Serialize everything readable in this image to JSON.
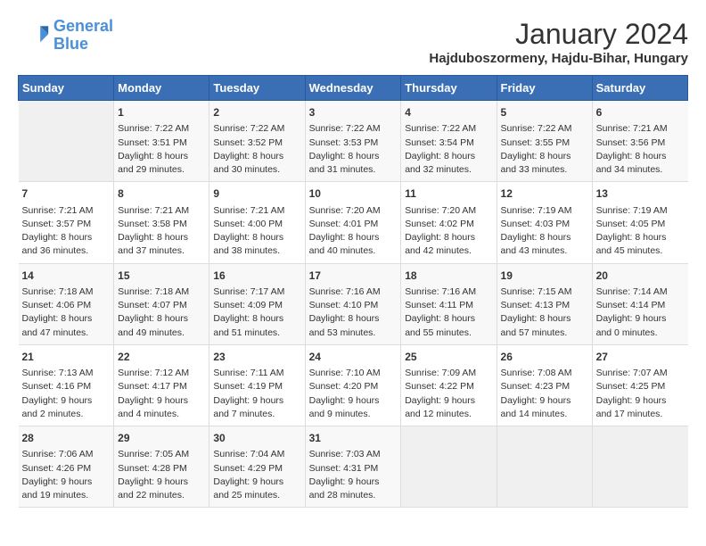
{
  "header": {
    "logo_line1": "General",
    "logo_line2": "Blue",
    "month_year": "January 2024",
    "location": "Hajduboszormeny, Hajdu-Bihar, Hungary"
  },
  "weekdays": [
    "Sunday",
    "Monday",
    "Tuesday",
    "Wednesday",
    "Thursday",
    "Friday",
    "Saturday"
  ],
  "weeks": [
    [
      {
        "day": "",
        "info": ""
      },
      {
        "day": "1",
        "info": "Sunrise: 7:22 AM\nSunset: 3:51 PM\nDaylight: 8 hours\nand 29 minutes."
      },
      {
        "day": "2",
        "info": "Sunrise: 7:22 AM\nSunset: 3:52 PM\nDaylight: 8 hours\nand 30 minutes."
      },
      {
        "day": "3",
        "info": "Sunrise: 7:22 AM\nSunset: 3:53 PM\nDaylight: 8 hours\nand 31 minutes."
      },
      {
        "day": "4",
        "info": "Sunrise: 7:22 AM\nSunset: 3:54 PM\nDaylight: 8 hours\nand 32 minutes."
      },
      {
        "day": "5",
        "info": "Sunrise: 7:22 AM\nSunset: 3:55 PM\nDaylight: 8 hours\nand 33 minutes."
      },
      {
        "day": "6",
        "info": "Sunrise: 7:21 AM\nSunset: 3:56 PM\nDaylight: 8 hours\nand 34 minutes."
      }
    ],
    [
      {
        "day": "7",
        "info": "Sunrise: 7:21 AM\nSunset: 3:57 PM\nDaylight: 8 hours\nand 36 minutes."
      },
      {
        "day": "8",
        "info": "Sunrise: 7:21 AM\nSunset: 3:58 PM\nDaylight: 8 hours\nand 37 minutes."
      },
      {
        "day": "9",
        "info": "Sunrise: 7:21 AM\nSunset: 4:00 PM\nDaylight: 8 hours\nand 38 minutes."
      },
      {
        "day": "10",
        "info": "Sunrise: 7:20 AM\nSunset: 4:01 PM\nDaylight: 8 hours\nand 40 minutes."
      },
      {
        "day": "11",
        "info": "Sunrise: 7:20 AM\nSunset: 4:02 PM\nDaylight: 8 hours\nand 42 minutes."
      },
      {
        "day": "12",
        "info": "Sunrise: 7:19 AM\nSunset: 4:03 PM\nDaylight: 8 hours\nand 43 minutes."
      },
      {
        "day": "13",
        "info": "Sunrise: 7:19 AM\nSunset: 4:05 PM\nDaylight: 8 hours\nand 45 minutes."
      }
    ],
    [
      {
        "day": "14",
        "info": "Sunrise: 7:18 AM\nSunset: 4:06 PM\nDaylight: 8 hours\nand 47 minutes."
      },
      {
        "day": "15",
        "info": "Sunrise: 7:18 AM\nSunset: 4:07 PM\nDaylight: 8 hours\nand 49 minutes."
      },
      {
        "day": "16",
        "info": "Sunrise: 7:17 AM\nSunset: 4:09 PM\nDaylight: 8 hours\nand 51 minutes."
      },
      {
        "day": "17",
        "info": "Sunrise: 7:16 AM\nSunset: 4:10 PM\nDaylight: 8 hours\nand 53 minutes."
      },
      {
        "day": "18",
        "info": "Sunrise: 7:16 AM\nSunset: 4:11 PM\nDaylight: 8 hours\nand 55 minutes."
      },
      {
        "day": "19",
        "info": "Sunrise: 7:15 AM\nSunset: 4:13 PM\nDaylight: 8 hours\nand 57 minutes."
      },
      {
        "day": "20",
        "info": "Sunrise: 7:14 AM\nSunset: 4:14 PM\nDaylight: 9 hours\nand 0 minutes."
      }
    ],
    [
      {
        "day": "21",
        "info": "Sunrise: 7:13 AM\nSunset: 4:16 PM\nDaylight: 9 hours\nand 2 minutes."
      },
      {
        "day": "22",
        "info": "Sunrise: 7:12 AM\nSunset: 4:17 PM\nDaylight: 9 hours\nand 4 minutes."
      },
      {
        "day": "23",
        "info": "Sunrise: 7:11 AM\nSunset: 4:19 PM\nDaylight: 9 hours\nand 7 minutes."
      },
      {
        "day": "24",
        "info": "Sunrise: 7:10 AM\nSunset: 4:20 PM\nDaylight: 9 hours\nand 9 minutes."
      },
      {
        "day": "25",
        "info": "Sunrise: 7:09 AM\nSunset: 4:22 PM\nDaylight: 9 hours\nand 12 minutes."
      },
      {
        "day": "26",
        "info": "Sunrise: 7:08 AM\nSunset: 4:23 PM\nDaylight: 9 hours\nand 14 minutes."
      },
      {
        "day": "27",
        "info": "Sunrise: 7:07 AM\nSunset: 4:25 PM\nDaylight: 9 hours\nand 17 minutes."
      }
    ],
    [
      {
        "day": "28",
        "info": "Sunrise: 7:06 AM\nSunset: 4:26 PM\nDaylight: 9 hours\nand 19 minutes."
      },
      {
        "day": "29",
        "info": "Sunrise: 7:05 AM\nSunset: 4:28 PM\nDaylight: 9 hours\nand 22 minutes."
      },
      {
        "day": "30",
        "info": "Sunrise: 7:04 AM\nSunset: 4:29 PM\nDaylight: 9 hours\nand 25 minutes."
      },
      {
        "day": "31",
        "info": "Sunrise: 7:03 AM\nSunset: 4:31 PM\nDaylight: 9 hours\nand 28 minutes."
      },
      {
        "day": "",
        "info": ""
      },
      {
        "day": "",
        "info": ""
      },
      {
        "day": "",
        "info": ""
      }
    ]
  ]
}
